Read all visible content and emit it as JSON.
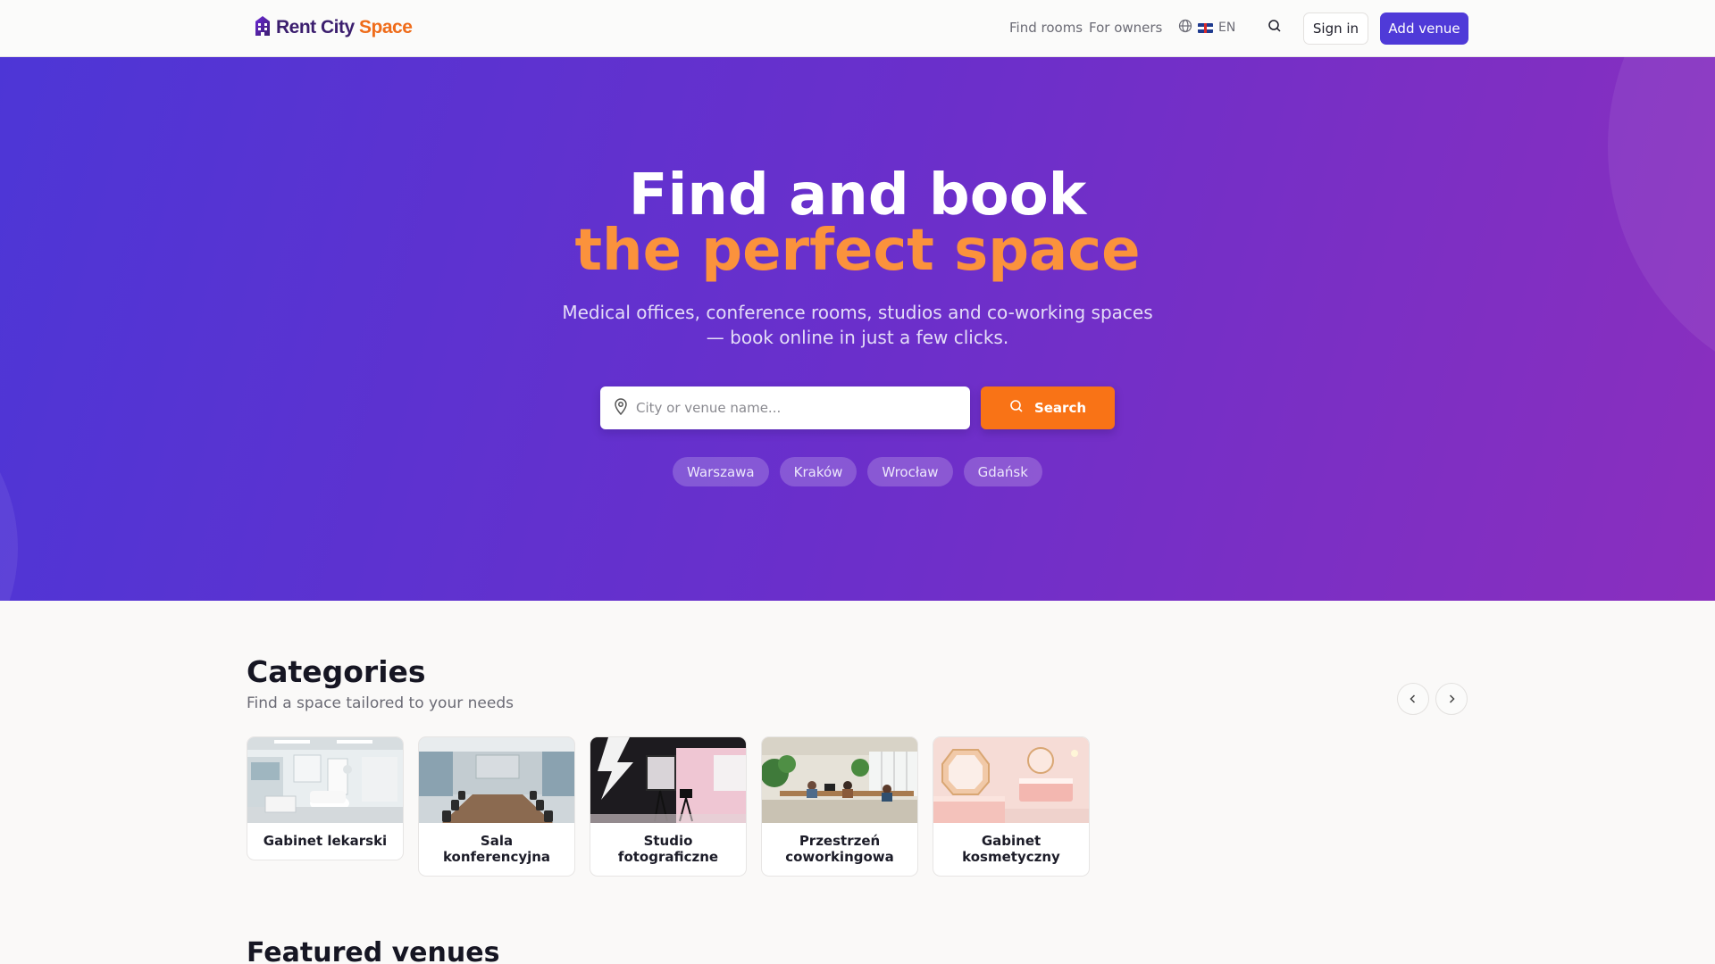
{
  "header": {
    "logo_part1": "Rent City",
    "logo_part2": "Space",
    "nav": [
      "Find rooms",
      "For owners"
    ],
    "language": "EN",
    "sign_in": "Sign in",
    "add_venue": "Add venue"
  },
  "hero": {
    "title_line1": "Find and book",
    "title_line2": "the perfect space",
    "subtitle_line1": "Medical offices, conference rooms, studios and co-working spaces",
    "subtitle_line2": "— book online in just a few clicks.",
    "search_placeholder": "City or venue name...",
    "search_button": "Search",
    "cities": [
      "Warszawa",
      "Kraków",
      "Wrocław",
      "Gdańsk"
    ]
  },
  "categories": {
    "title": "Categories",
    "subtitle": "Find a space tailored to your needs",
    "items": [
      {
        "label": "Gabinet lekarski"
      },
      {
        "label": "Sala konferencyjna"
      },
      {
        "label": "Studio fotograficzne"
      },
      {
        "label": "Przestrzeń coworkingowa"
      },
      {
        "label": "Gabinet kosmetyczny"
      }
    ]
  },
  "featured": {
    "title": "Featured venues"
  },
  "colors": {
    "primary": "#4f3ad8",
    "accent": "#f97316",
    "hero_accent_text": "#fb923c"
  }
}
